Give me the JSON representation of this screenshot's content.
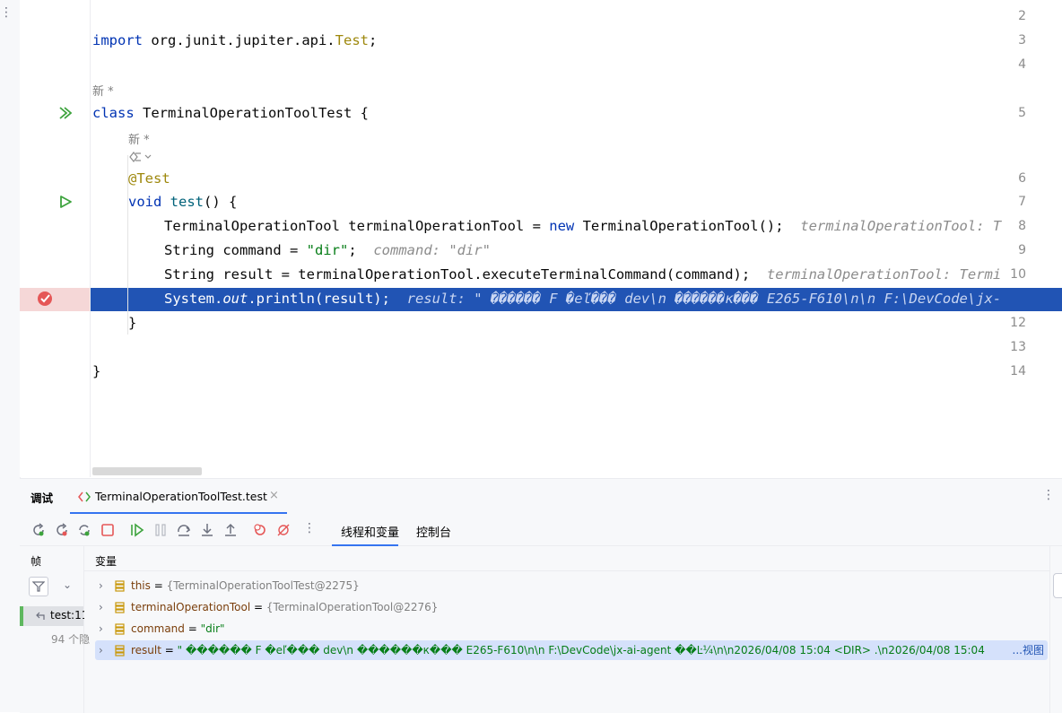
{
  "code": {
    "line_numbers": [
      "2",
      "3",
      "4",
      "5",
      "6",
      "7",
      "8",
      "9",
      "10",
      "12",
      "13",
      "14"
    ],
    "import_kw": "import",
    "import_pkg": "org.junit.jupiter.api.",
    "import_cls": "Test",
    "import_end": ";",
    "new_marker_1": "新 *",
    "class_kw": "class",
    "class_name": " TerminalOperationToolTest {",
    "new_marker_2": "新 *",
    "annotation": "@Test",
    "void_kw": "void",
    "method": "test",
    "method_rest": "() {",
    "l8_a": "TerminalOperationTool terminalOperationTool = ",
    "l8_new": "new",
    "l8_b": " TerminalOperationTool();",
    "l8_hint": "terminalOperationTool: T",
    "l9_a": "String command = ",
    "l9_str": "\"dir\"",
    "l9_b": ";",
    "l9_hint": "command: \"dir\"",
    "l10_a": "String result = terminalOperationTool.executeTerminalCommand(command);",
    "l10_hint": "terminalOperationTool: Termi",
    "l11_a": "System.",
    "l11_out": "out",
    "l11_b": ".println(result);",
    "l11_hint": "result: \" ������ F �еľ��� dev\\n ������к��� E265-F610\\n\\n F:\\DevCode\\jx-",
    "close_method": "}",
    "close_class": "}"
  },
  "debug": {
    "title": "调试",
    "tab_label": "TerminalOperationToolTest.test",
    "subtabs": [
      "线程和变量",
      "控制台"
    ],
    "frames_label": "帧",
    "frame_item": "test:11",
    "frames_more": "94 个隐",
    "vars_label": "变量",
    "variables": [
      {
        "name": "this",
        "eq": " = ",
        "value": "{TerminalOperationToolTest@2275}"
      },
      {
        "name": "terminalOperationTool",
        "eq": " = ",
        "value": "{TerminalOperationTool@2276}"
      },
      {
        "name": "command",
        "eq": " = ",
        "value": "\"dir\""
      },
      {
        "name": "result",
        "eq": " = ",
        "value": "\" ������ F �еľ��� dev\\n ������к��� E265-F610\\n\\n F:\\DevCode\\jx-ai-agent ��Ŀ¼\\n\\n2026/04/08  15:04    <DIR>          .\\n2026/04/08  15:04",
        "link": "...视图"
      }
    ]
  },
  "colors": {
    "selection": "#2154b4",
    "keyword": "#0033b3",
    "string": "#067d17",
    "annotation": "#9e880d",
    "run_icon": "#3da33d",
    "breakpoint": "#e55757",
    "accent": "#3574f0"
  }
}
